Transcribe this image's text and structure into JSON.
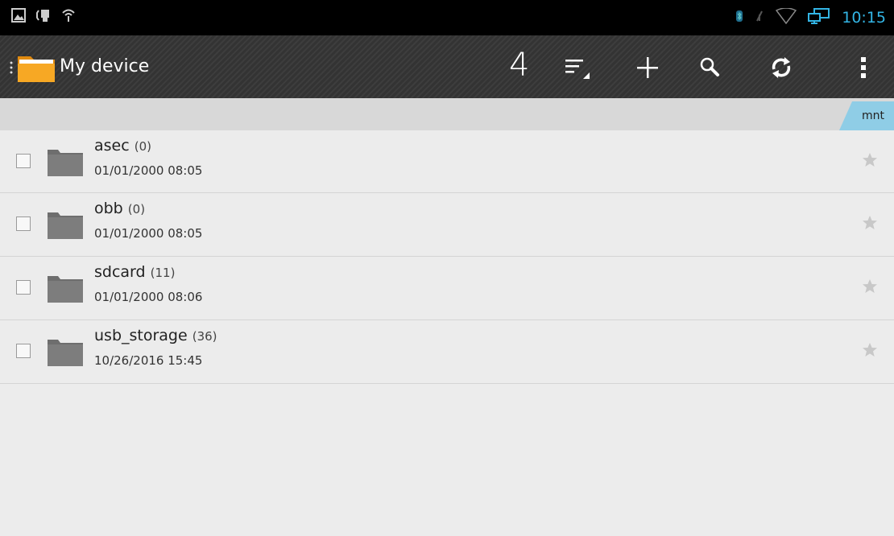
{
  "status_bar": {
    "time": "10:15",
    "left_icons": [
      "picture-icon",
      "usb-debug-icon",
      "signal-icon"
    ],
    "right_icons": [
      "bluetooth-icon",
      "no-signal-icon",
      "wifi-icon",
      "network-icon"
    ]
  },
  "action_bar": {
    "title": "My device",
    "count": "4",
    "actions": [
      "sort-icon",
      "add-icon",
      "search-icon",
      "refresh-icon",
      "overflow-menu-icon"
    ]
  },
  "breadcrumb": {
    "current": "mnt"
  },
  "files": [
    {
      "name": "asec",
      "count": "(0)",
      "date": "01/01/2000 08:05"
    },
    {
      "name": "obb",
      "count": "(0)",
      "date": "01/01/2000 08:05"
    },
    {
      "name": "sdcard",
      "count": "(11)",
      "date": "01/01/2000 08:06"
    },
    {
      "name": "usb_storage",
      "count": "(36)",
      "date": "10/26/2016 15:45"
    }
  ],
  "colors": {
    "accent": "#33b5e5",
    "breadcrumb": "#8fcde6",
    "folder": "#777777",
    "app_folder": "#f5a623"
  }
}
